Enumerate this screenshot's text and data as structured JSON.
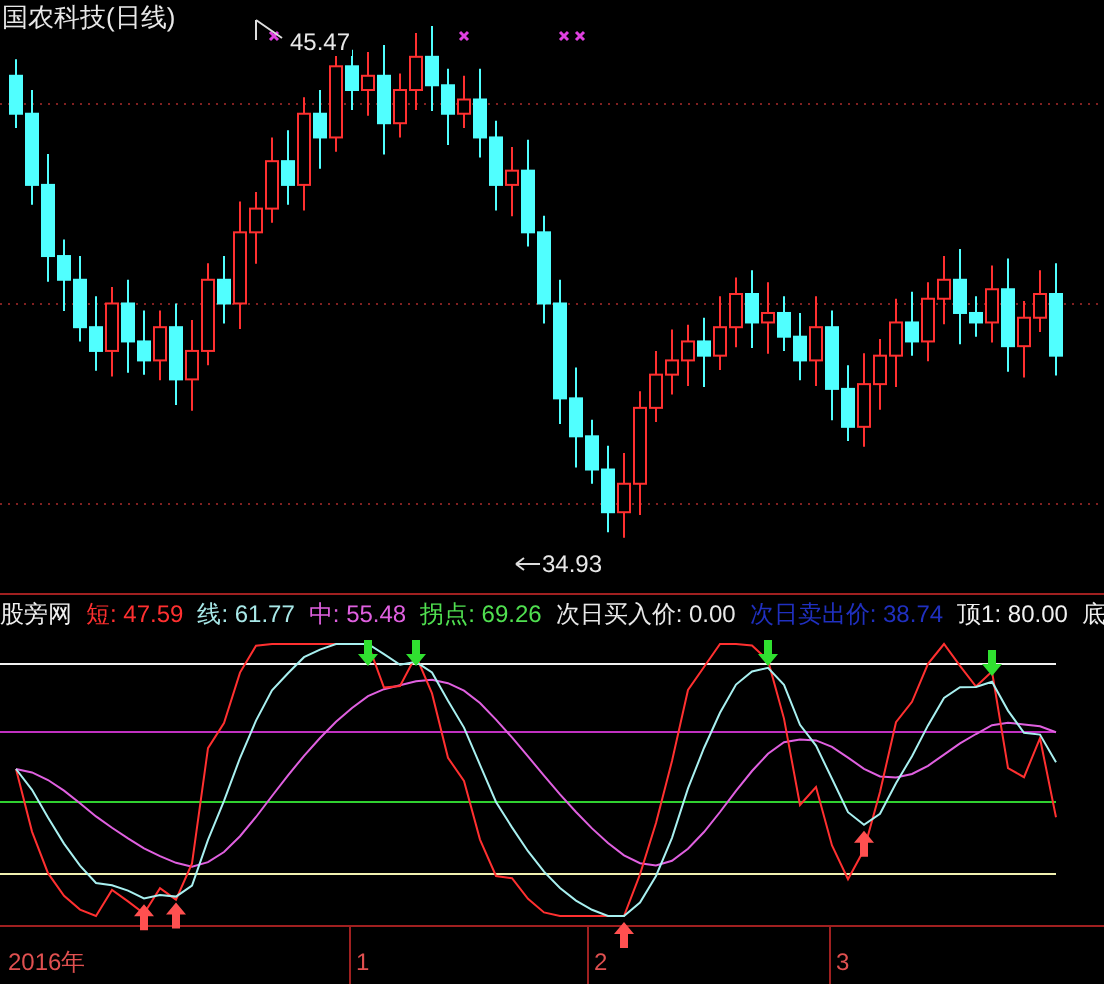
{
  "chart_title": "国农科技(日线)",
  "price_labels": [
    {
      "text": "45.47"
    },
    {
      "text": "34.93"
    }
  ],
  "indicator": {
    "name": "股旁网",
    "readings": [
      {
        "text": "短: 47.59",
        "color": "#ff3030"
      },
      {
        "text": "线: 61.77",
        "color": "#a8e8e8"
      },
      {
        "text": "中: 55.48",
        "color": "#e060e0"
      },
      {
        "text": "拐点: 69.26",
        "color": "#50e050"
      },
      {
        "text": "次日买入价: 0.00",
        "color": "#e8e8e8"
      },
      {
        "text": "次日卖出价: 38.74",
        "color": "#2030c0"
      },
      {
        "text": "顶1: 80.00",
        "color": "#f0f0f0"
      },
      {
        "text": "底",
        "color": "#f0f0f0"
      }
    ]
  },
  "x_axis": {
    "labels": [
      "2016年",
      "1",
      "2",
      "3"
    ]
  }
}
